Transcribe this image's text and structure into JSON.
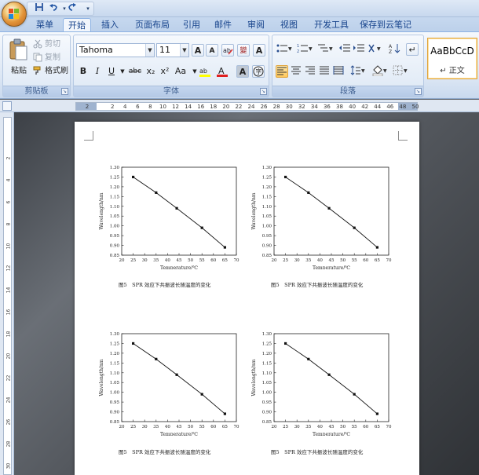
{
  "quick_access": {
    "save_icon": "save-icon",
    "undo_icon": "undo-icon",
    "redo_icon": "redo-icon",
    "more": "▾"
  },
  "tabs": [
    "菜单",
    "开始",
    "插入",
    "页面布局",
    "引用",
    "邮件",
    "审阅",
    "视图",
    "开发工具",
    "保存到云笔记"
  ],
  "active_tab": "开始",
  "clipboard": {
    "paste": "粘贴",
    "cut": "剪切",
    "copy": "复制",
    "format_painter": "格式刷",
    "label": "剪贴板"
  },
  "font": {
    "name": "Tahoma",
    "size": "11",
    "label": "字体",
    "buttons": {
      "grow": "A",
      "shrink": "A",
      "change_case": "Aa",
      "bold": "B",
      "italic": "I",
      "underline": "U",
      "strike": "abc",
      "subscript": "x₂",
      "superscript": "x²"
    }
  },
  "paragraph": {
    "label": "段落"
  },
  "styles": {
    "sample": "AaBbCcD",
    "name": "↵ 正文"
  },
  "ruler": {
    "ticks": [
      "2",
      "",
      "2",
      "4",
      "6",
      "8",
      "10",
      "12",
      "14",
      "16",
      "18",
      "20",
      "22",
      "24",
      "26",
      "28",
      "30",
      "32",
      "34",
      "36",
      "38",
      "40",
      "42",
      "44",
      "46",
      "48",
      "50"
    ]
  },
  "vruler": {
    "ticks": [
      "2",
      "4",
      "6",
      "8",
      "10",
      "12",
      "14",
      "16",
      "18",
      "20",
      "22",
      "24",
      "26",
      "28",
      "30"
    ]
  },
  "charts": [
    {
      "caption": "图5　SPR 效应下共振波长随温度的变化"
    },
    {
      "caption": "图5　SPR 效应下共振波长随温度的变化"
    },
    {
      "caption": "图5　SPR 效应下共振波长随温度的变化"
    },
    {
      "caption": "图5　SPR 效应下共振波长随温度的变化"
    }
  ],
  "chart_data": [
    {
      "type": "line",
      "xlabel": "Temperature/℃",
      "ylabel": "Wavelength/nm",
      "xlim": [
        20,
        70
      ],
      "ylim": [
        0.85,
        1.3
      ],
      "xticks": [
        "20",
        "25",
        "30",
        "35",
        "40",
        "45",
        "50",
        "55",
        "60",
        "65",
        "70"
      ],
      "yticks": [
        "0.85",
        "0.90",
        "0.95",
        "1.00",
        "1.05",
        "1.10",
        "1.15",
        "1.20",
        "1.25",
        "1.30"
      ],
      "x": [
        25,
        35,
        44,
        55,
        65
      ],
      "y": [
        1.25,
        1.17,
        1.09,
        0.99,
        0.89
      ]
    },
    {
      "type": "line",
      "xlabel": "Temperature/℃",
      "ylabel": "Wavelength/nm",
      "xlim": [
        20,
        70
      ],
      "ylim": [
        0.85,
        1.3
      ],
      "xticks": [
        "20",
        "25",
        "30",
        "35",
        "40",
        "45",
        "50",
        "55",
        "60",
        "65",
        "70"
      ],
      "yticks": [
        "0.85",
        "0.90",
        "0.95",
        "1.00",
        "1.05",
        "1.10",
        "1.15",
        "1.20",
        "1.25",
        "1.30"
      ],
      "x": [
        25,
        35,
        44,
        55,
        65
      ],
      "y": [
        1.25,
        1.17,
        1.09,
        0.99,
        0.89
      ]
    },
    {
      "type": "line",
      "xlabel": "Temperature/℃",
      "ylabel": "Wavelength/nm",
      "xlim": [
        20,
        70
      ],
      "ylim": [
        0.85,
        1.3
      ],
      "xticks": [
        "20",
        "25",
        "30",
        "35",
        "40",
        "45",
        "50",
        "55",
        "60",
        "65",
        "70"
      ],
      "yticks": [
        "0.85",
        "0.90",
        "0.95",
        "1.00",
        "1.05",
        "1.10",
        "1.15",
        "1.20",
        "1.25",
        "1.30"
      ],
      "x": [
        25,
        35,
        44,
        55,
        65
      ],
      "y": [
        1.25,
        1.17,
        1.09,
        0.99,
        0.89
      ]
    },
    {
      "type": "line",
      "xlabel": "Temperature/℃",
      "ylabel": "Wavelength/nm",
      "xlim": [
        20,
        70
      ],
      "ylim": [
        0.85,
        1.3
      ],
      "xticks": [
        "20",
        "25",
        "30",
        "35",
        "40",
        "45",
        "50",
        "55",
        "60",
        "65",
        "70"
      ],
      "yticks": [
        "0.85",
        "0.90",
        "0.95",
        "1.00",
        "1.05",
        "1.10",
        "1.15",
        "1.20",
        "1.25",
        "1.30"
      ],
      "x": [
        25,
        35,
        44,
        55,
        65
      ],
      "y": [
        1.25,
        1.17,
        1.09,
        0.99,
        0.89
      ]
    }
  ]
}
